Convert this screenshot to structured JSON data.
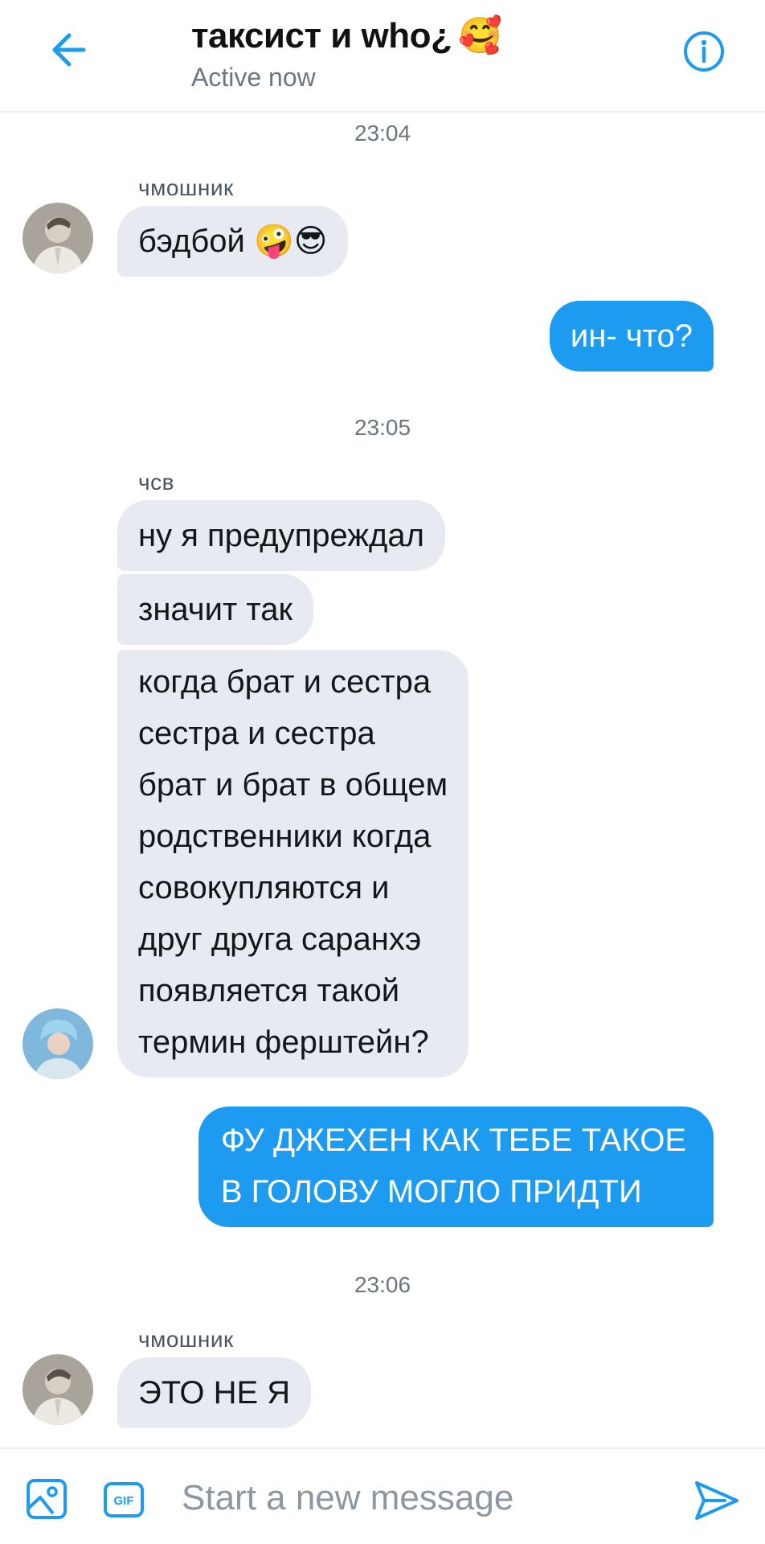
{
  "header": {
    "title": "таксист и who¿",
    "title_emoji": "🥰",
    "status": "Active now"
  },
  "accent_color": "#1d9bf0",
  "incoming_bubble_color": "#e7eaf0",
  "messages": [
    {
      "type": "timestamp",
      "text": "23:04"
    },
    {
      "type": "sender",
      "text": "чмошник"
    },
    {
      "type": "incoming",
      "text": "бэдбой 🤪😎"
    },
    {
      "type": "outgoing",
      "text": "ин- что?"
    },
    {
      "type": "timestamp",
      "text": "23:05"
    },
    {
      "type": "sender",
      "text": "чсв"
    },
    {
      "type": "incoming",
      "text": "ну я предупреждал"
    },
    {
      "type": "incoming",
      "text": "значит так"
    },
    {
      "type": "incoming",
      "lines": [
        "когда брат и сестра",
        "сестра и сестра",
        "брат и брат в общем",
        "родственники когда",
        "совокупляются и",
        "друг друга саранхэ",
        "появляется такой",
        "термин ферштейн?"
      ]
    },
    {
      "type": "outgoing",
      "lines": [
        "ФУ ДЖЕХЕН КАК ТЕБЕ ТАКОЕ",
        "В ГОЛОВУ МОГЛО ПРИДТИ"
      ]
    },
    {
      "type": "timestamp",
      "text": "23:06"
    },
    {
      "type": "sender",
      "text": "чмошник"
    },
    {
      "type": "incoming",
      "text": "ЭТО НЕ Я"
    }
  ],
  "composer": {
    "placeholder": "Start a new message",
    "value": "",
    "gif_label": "GIF"
  },
  "icons": {
    "back": "arrow-left-icon",
    "info": "info-icon",
    "image": "image-icon",
    "gif": "gif-icon",
    "send": "send-icon"
  }
}
